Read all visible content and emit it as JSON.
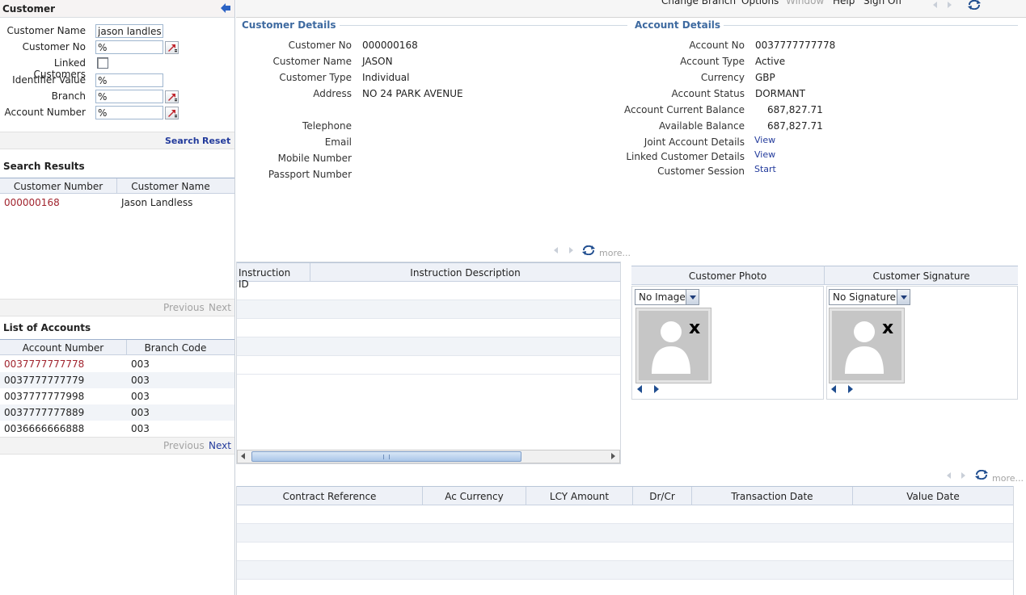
{
  "left": {
    "title": "Customer",
    "form": {
      "customer_name_label": "Customer Name",
      "customer_name_value": "jason landless",
      "customer_no_label": "Customer No",
      "customer_no_value": "%",
      "linked_customers_label": "Linked Customers",
      "identifier_value_label": "Identifier Value",
      "identifier_value_value": "%",
      "branch_label": "Branch",
      "branch_value": "%",
      "account_number_label": "Account Number",
      "account_number_value": "%"
    },
    "search_label": "Search",
    "reset_label": "Reset",
    "search_results": {
      "title": "Search Results",
      "columns": [
        "Customer Number",
        "Customer Name"
      ],
      "rows": [
        {
          "number": "000000168",
          "name": "Jason Landless"
        }
      ],
      "previous": "Previous",
      "next": "Next"
    },
    "accounts": {
      "title": "List of Accounts",
      "columns": [
        "Account Number",
        "Branch Code"
      ],
      "rows": [
        {
          "number": "0037777777778",
          "branch": "003"
        },
        {
          "number": "0037777777779",
          "branch": "003"
        },
        {
          "number": "0037777777998",
          "branch": "003"
        },
        {
          "number": "0037777777889",
          "branch": "003"
        },
        {
          "number": "0036666666888",
          "branch": "003"
        }
      ],
      "previous": "Previous",
      "next": "Next"
    }
  },
  "topbar": {
    "menu": [
      "Change Branch",
      "Options",
      "Window",
      "Help",
      "Sign Off"
    ]
  },
  "customer_details": {
    "title": "Customer Details",
    "fields": [
      {
        "label": "Customer No",
        "value": "000000168"
      },
      {
        "label": "Customer Name",
        "value": "JASON"
      },
      {
        "label": "Customer Type",
        "value": "Individual"
      },
      {
        "label": "Address",
        "value": "NO 24 PARK AVENUE"
      },
      {
        "label": "Telephone",
        "value": ""
      },
      {
        "label": "Email",
        "value": ""
      },
      {
        "label": "Mobile Number",
        "value": ""
      },
      {
        "label": "Passport Number",
        "value": ""
      }
    ]
  },
  "account_details": {
    "title": "Account Details",
    "fields": [
      {
        "label": "Account No",
        "value": "0037777777778"
      },
      {
        "label": "Account Type",
        "value": "Active"
      },
      {
        "label": "Currency",
        "value": "GBP"
      },
      {
        "label": "Account Status",
        "value": "DORMANT"
      },
      {
        "label": "Account Current Balance",
        "value": "687,827.71"
      },
      {
        "label": "Available Balance",
        "value": "687,827.71"
      },
      {
        "label": "Joint Account Details",
        "value": "View"
      },
      {
        "label": "Linked Customer Details",
        "value": "View"
      },
      {
        "label": "Customer Session",
        "value": "Start"
      }
    ]
  },
  "more_label": "more...",
  "instructions": {
    "columns": [
      "Instruction ID",
      "Instruction Description"
    ]
  },
  "photo": {
    "title": "Customer Photo",
    "select_value": "No Image"
  },
  "signature": {
    "title": "Customer Signature",
    "select_value": "No Signature"
  },
  "transactions": {
    "columns": [
      "Contract Reference",
      "Ac Currency",
      "LCY Amount",
      "Dr/Cr",
      "Transaction Date",
      "Value Date"
    ]
  },
  "colors": {
    "link": "#233b9c",
    "legend": "#3e6aa0",
    "account_red": "#a1242e"
  }
}
